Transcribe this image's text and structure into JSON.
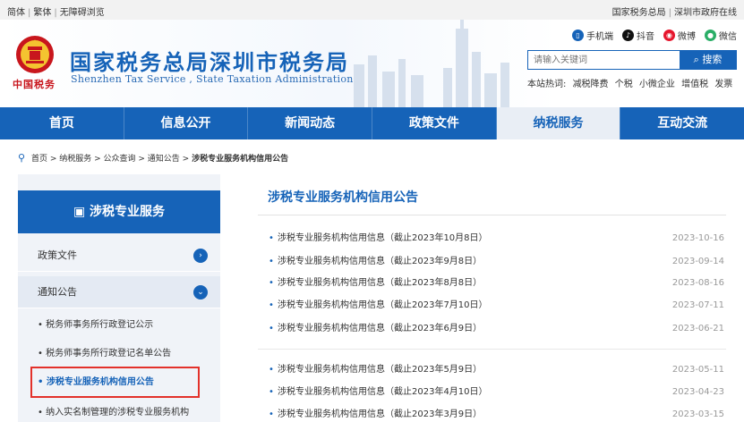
{
  "topbar": {
    "left": [
      "简体",
      "繁体",
      "无障碍浏览"
    ],
    "right": [
      "国家税务总局",
      "深圳市政府在线"
    ]
  },
  "header": {
    "emblem_text": "中国税务",
    "title": "国家税务总局深圳市税务局",
    "subtitle": "Shenzhen Tax Service , State Taxation Administration",
    "social": [
      {
        "label": "手机端",
        "icon": "phone-icon",
        "color": "#1663b8"
      },
      {
        "label": "抖音",
        "icon": "douyin-icon",
        "color": "#111111"
      },
      {
        "label": "微博",
        "icon": "weibo-icon",
        "color": "#e6162d"
      },
      {
        "label": "微信",
        "icon": "wechat-icon",
        "color": "#2aae67"
      }
    ],
    "search_placeholder": "请输入关键词",
    "search_button": "搜索",
    "hot_label": "本站热词:",
    "hot_words": [
      "减税降费",
      "个税",
      "小微企业",
      "增值税",
      "发票"
    ]
  },
  "nav": {
    "items": [
      "首页",
      "信息公开",
      "新闻动态",
      "政策文件",
      "纳税服务",
      "互动交流"
    ],
    "active": "纳税服务"
  },
  "breadcrumb": [
    "首页",
    "纳税服务",
    "公众查询",
    "通知公告",
    "涉税专业服务机构信用公告"
  ],
  "sidebar": {
    "title": "涉税专业服务",
    "rows": [
      "政策文件",
      "通知公告"
    ],
    "sub_items": [
      "税务师事务所行政登记公示",
      "税务师事务所行政登记名单公告",
      "涉税专业服务机构信用公告",
      "纳入实名制管理的涉税专业服务机构"
    ],
    "active_sub": "涉税专业服务机构信用公告"
  },
  "content": {
    "title": "涉税专业服务机构信用公告",
    "items": [
      {
        "text": "涉税专业服务机构信用信息（截止2023年10月8日）",
        "date": "2023-10-16"
      },
      {
        "text": "涉税专业服务机构信用信息（截止2023年9月8日）",
        "date": "2023-09-14"
      },
      {
        "text": "涉税专业服务机构信用信息（截止2023年8月8日）",
        "date": "2023-08-16"
      },
      {
        "text": "涉税专业服务机构信用信息（截止2023年7月10日）",
        "date": "2023-07-11"
      },
      {
        "text": "涉税专业服务机构信用信息（截止2023年6月9日）",
        "date": "2023-06-21"
      },
      {
        "text": "涉税专业服务机构信用信息（截止2023年5月9日）",
        "date": "2023-05-11"
      },
      {
        "text": "涉税专业服务机构信用信息（截止2023年4月10日）",
        "date": "2023-04-23"
      },
      {
        "text": "涉税专业服务机构信用信息（截止2023年3月9日）",
        "date": "2023-03-15"
      }
    ]
  },
  "colors": {
    "brand": "#1663b8",
    "highlight": "#e3312a"
  }
}
